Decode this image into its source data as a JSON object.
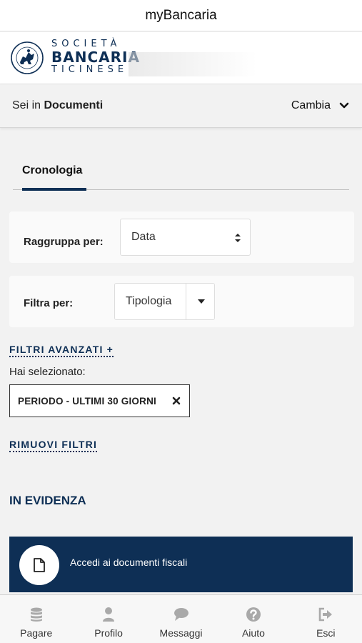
{
  "app": {
    "title": "myBancaria"
  },
  "brand": {
    "line1": "SOCIETÀ",
    "line2": "BANCARIA",
    "line3": "TICINESE"
  },
  "section": {
    "prefix": "Sei in",
    "name": "Documenti",
    "change_label": "Cambia"
  },
  "tabs": [
    {
      "label": "Cronologia",
      "active": true
    }
  ],
  "group_by": {
    "label": "Raggruppa per:",
    "value": "Data"
  },
  "filter_by": {
    "label": "Filtra per:",
    "value": "Tipologia"
  },
  "advanced_filters": {
    "label": "FILTRI AVANZATI +"
  },
  "selection": {
    "label": "Hai selezionato:",
    "chips": [
      {
        "text": "PERIODO - ULTIMI 30 GIORNI"
      }
    ]
  },
  "remove_filters": {
    "label": "RIMUOVI FILTRI"
  },
  "highlights": {
    "title": "IN EVIDENZA",
    "items": [
      {
        "text": "Accedi ai documenti fiscali",
        "icon": "document-icon"
      }
    ]
  },
  "bottom_nav": [
    {
      "label": "Pagare",
      "icon": "coins-icon"
    },
    {
      "label": "Profilo",
      "icon": "user-icon"
    },
    {
      "label": "Messaggi",
      "icon": "chat-icon"
    },
    {
      "label": "Aiuto",
      "icon": "help-icon"
    },
    {
      "label": "Esci",
      "icon": "logout-icon"
    }
  ],
  "colors": {
    "brand_navy": "#0e2f55",
    "background": "#f2f2f2",
    "icon_gray": "#a9a9a9"
  }
}
